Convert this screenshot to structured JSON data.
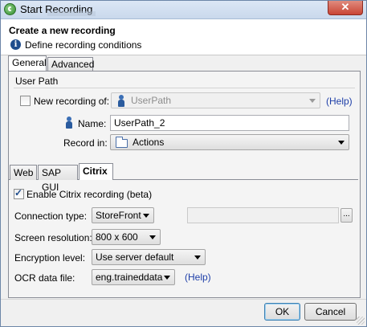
{
  "window": {
    "title": "Start Recording",
    "close_label": "✕"
  },
  "header": {
    "title": "Create a new recording",
    "subtitle": "Define recording conditions"
  },
  "tabs": {
    "general": "General",
    "advanced": "Advanced"
  },
  "user_path": {
    "group_label": "User Path",
    "new_recording_label": "New recording of:",
    "new_recording_checked": false,
    "user_path_select": "UserPath",
    "help_label": "(Help)",
    "name_label": "Name:",
    "name_value": "UserPath_2",
    "record_in_label": "Record in:",
    "record_in_value": "Actions"
  },
  "subtabs": {
    "web": "Web",
    "sap": "SAP GUI",
    "citrix": "Citrix"
  },
  "citrix": {
    "enable_label": "Enable Citrix recording (beta)",
    "enable_checked": true,
    "connection_type_label": "Connection type:",
    "connection_type_value": "StoreFront",
    "connection_path_value": "",
    "ellipsis_label": "...",
    "screen_resolution_label": "Screen resolution:",
    "screen_resolution_value": "800 x 600",
    "encryption_label": "Encryption level:",
    "encryption_value": "Use server default",
    "ocr_label": "OCR data file:",
    "ocr_value": "eng.traineddata",
    "ocr_help_label": "(Help)"
  },
  "footer": {
    "ok_label": "OK",
    "cancel_label": "Cancel"
  }
}
